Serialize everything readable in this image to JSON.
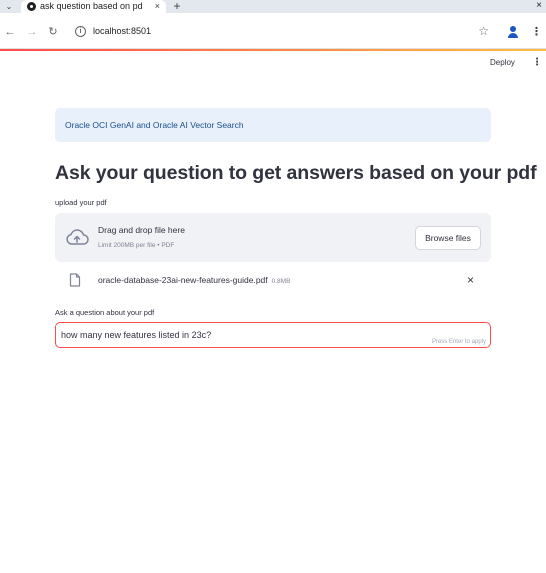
{
  "browser": {
    "tab": {
      "title": "ask question based on pd",
      "close": "×"
    },
    "tab_dropdown": "⌄",
    "new_tab": "+",
    "window_close": "×",
    "nav": {
      "back": "←",
      "forward": "→",
      "reload": "↻"
    },
    "site_info": "i",
    "url": "localhost:8501",
    "bookmark": "☆",
    "menu": "⋮"
  },
  "app": {
    "deploy_label": "Deploy",
    "menu": "⋮",
    "accent_color": "#ff4b4b",
    "info_message": "Oracle OCI GenAI and Oracle AI Vector Search",
    "title": "Ask your question to get answers based on your pdf",
    "uploader": {
      "label": "upload your pdf",
      "drop_title": "Drag and drop file here",
      "drop_subtitle": "Limit 200MB per file • PDF",
      "browse_label": "Browse files"
    },
    "uploaded_file": {
      "name": "oracle-database-23ai-new-features-guide.pdf",
      "size": "0.8MB",
      "remove": "×"
    },
    "question": {
      "label": "Ask a question about your pdf",
      "value": "how many new features listed in 23c?",
      "hint": "Press Enter to apply"
    }
  }
}
